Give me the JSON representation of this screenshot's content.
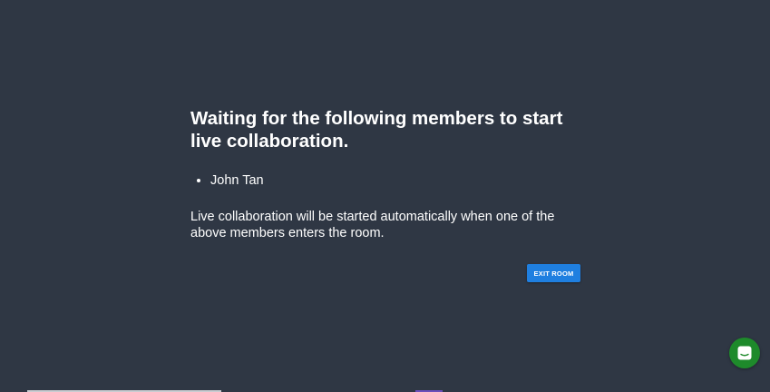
{
  "waiting": {
    "heading": "Waiting for the following members to start live collaboration.",
    "members": [
      "John Tan"
    ],
    "info": "Live collaboration will be started automatically when one of the above members enters the room."
  },
  "actions": {
    "exit_label": "EXIT ROOM"
  },
  "colors": {
    "background": "#2f3744",
    "button": "#1f7fe0",
    "chat_launcher": "#1e8a2b"
  },
  "icons": {
    "chat_launcher": "chat-icon"
  }
}
